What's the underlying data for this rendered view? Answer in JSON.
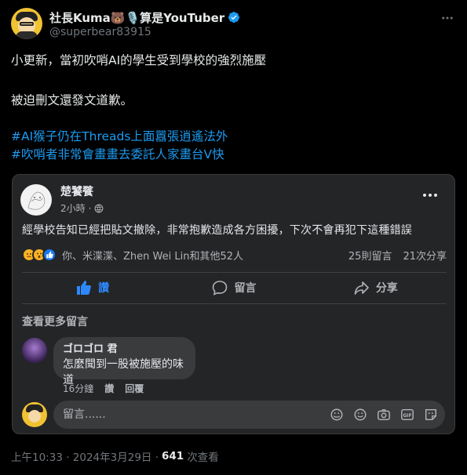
{
  "author": {
    "display_name": "社長Kuma🐻🎙️算是YouTuber",
    "handle": "@superbear83915"
  },
  "tweet": {
    "line1": "小更新，當初吹哨AI的學生受到學校的強烈施壓",
    "line2": "被迫刪文還發文道歉。",
    "hashtag1": "#AI猴子仍在Threads上面囂張逍遙法外",
    "hashtag2": "#吹哨者非常會畫畫去委託人家畫台V快"
  },
  "fb_post": {
    "page_name": "楚饕餮",
    "time": "2小時",
    "dot": "·",
    "text": "經學校告知已經把貼文撤除，非常抱歉造成各方困擾，下次不會再犯下這種錯誤",
    "reactors": "你、米渫渫、Zhen Wei Lin和其他52人",
    "comments_count": "25則留言",
    "shares_count": "21次分享",
    "like_label": "讚",
    "comment_label": "留言",
    "share_label": "分享",
    "view_more": "查看更多留言",
    "comment": {
      "author": "ゴロゴロ 君",
      "text": "怎麼聞到一股被施壓的味道",
      "time": "16分鐘",
      "like": "讚",
      "reply": "回覆"
    },
    "input_placeholder": "留言......",
    "colors": {
      "like_blue": "#2d88ff",
      "card_bg": "#242526",
      "bubble_bg": "#3a3b3c"
    }
  },
  "footer": {
    "timestamp": "上午10:33 · 2024年3月29日 ·",
    "views_count": "641",
    "views_label": "次查看"
  },
  "icons": [
    "verified-badge-icon",
    "more-icon",
    "globe-icon",
    "thumbs-up-icon",
    "comment-icon",
    "share-icon",
    "sticker-icon",
    "emoji-icon",
    "camera-icon",
    "gif-icon",
    "sticker-alt-icon"
  ]
}
